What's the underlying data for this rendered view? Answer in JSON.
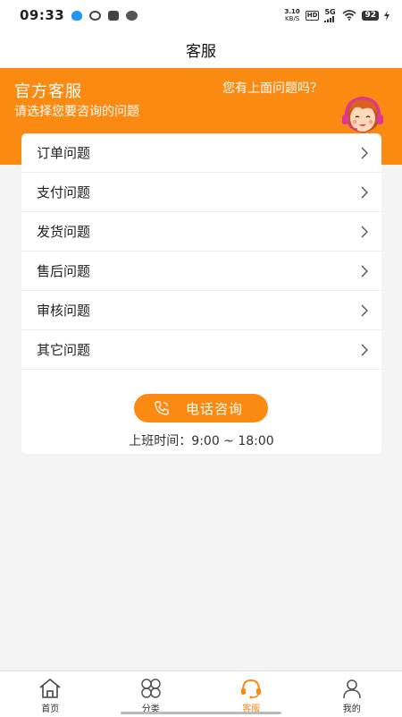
{
  "status_bar": {
    "time": "09:33",
    "net_speed_value": "3.10",
    "net_speed_unit": "KB/S",
    "hd_label": "HD",
    "network_label": "5G",
    "battery": "92"
  },
  "title": "客服",
  "banner": {
    "title": "官方客服",
    "subtitle": "请选择您要咨询的问题",
    "question": "您有上面问题吗？"
  },
  "menu": {
    "items": [
      {
        "label": "订单问题"
      },
      {
        "label": "支付问题"
      },
      {
        "label": "发货问题"
      },
      {
        "label": "售后问题"
      },
      {
        "label": "审核问题"
      },
      {
        "label": "其它问题"
      }
    ]
  },
  "phone_button": {
    "label": "电话咨询"
  },
  "hours": {
    "label": "上班时间：",
    "value": "9:00 ~ 18:00"
  },
  "bottom_nav": {
    "items": [
      {
        "label": "首页",
        "icon": "home-icon"
      },
      {
        "label": "分类",
        "icon": "category-icon"
      },
      {
        "label": "客服",
        "icon": "headset-icon",
        "active": true
      },
      {
        "label": "我的",
        "icon": "user-icon"
      }
    ]
  },
  "colors": {
    "accent": "#fb8a12",
    "background": "#f4f4f4"
  }
}
